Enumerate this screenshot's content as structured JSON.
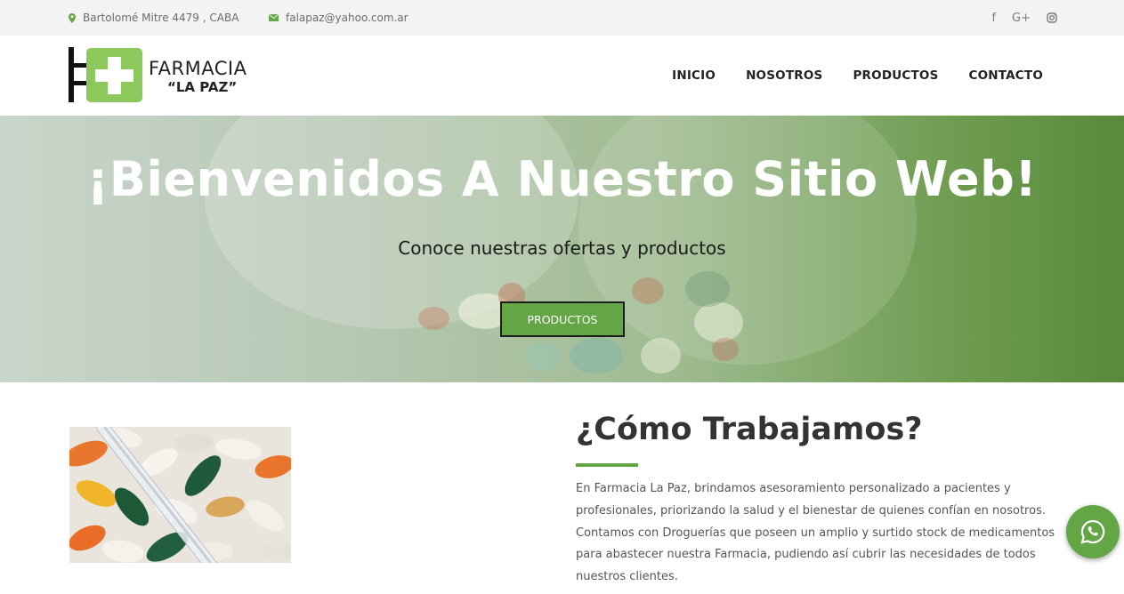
{
  "topbar": {
    "address": "Bartolomé Mitre 4479 , CABA",
    "email": "falapaz@yahoo.com.ar",
    "socials": [
      "f",
      "G+",
      "instagram"
    ]
  },
  "logo": {
    "line1": "FARMACIA",
    "line2": "“LA PAZ”"
  },
  "nav": {
    "items": [
      "INICIO",
      "NOSOTROS",
      "PRODUCTOS",
      "CONTACTO"
    ]
  },
  "hero": {
    "title": "¡Bienvenidos A Nuestro Sitio Web!",
    "subtitle": "Conoce nuestras ofertas y productos",
    "button": "PRODUCTOS"
  },
  "about": {
    "title": "¿Cómo Trabajamos?",
    "text": "En Farmacia La Paz, brindamos asesoramiento personalizado a pacientes y profesionales, priorizando la salud y el bienestar de quienes confían en nosotros. Contamos con Droguerías que poseen un amplio y surtido stock de medicamentos para abastecer nuestra Farmacia, pudiendo así cubrir las necesidades de todos nuestros clientes."
  },
  "colors": {
    "accent": "#64a546",
    "topbar_bg": "#f3f3f3",
    "text_dark": "#222222"
  }
}
